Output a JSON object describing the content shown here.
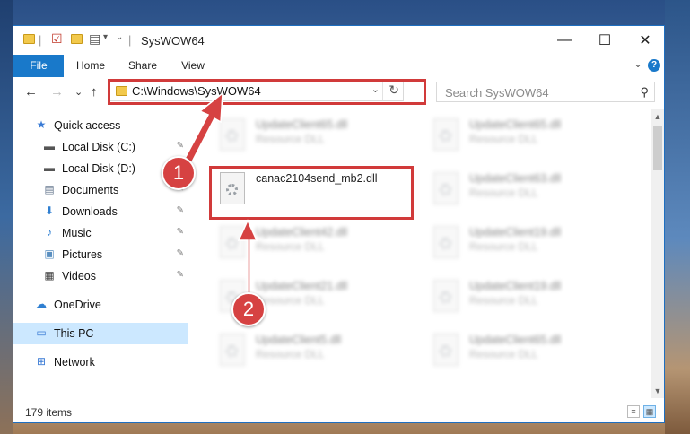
{
  "window": {
    "title": "SysWOW64",
    "controls": {
      "minimize": "—",
      "maximize": "☐",
      "close": "✕"
    }
  },
  "ribbon": {
    "tabs": [
      "File",
      "Home",
      "Share",
      "View"
    ],
    "expand_glyph": "⌄",
    "help_glyph": "?"
  },
  "nav": {
    "back": "←",
    "forward": "→",
    "recent": "⌄",
    "up": "↑",
    "address": "C:\\Windows\\SysWOW64",
    "address_dropdown": "⌄",
    "refresh": "↻",
    "search_placeholder": "Search SysWOW64"
  },
  "sidebar": {
    "items": [
      {
        "label": "Quick access",
        "icon": "star-icon",
        "glyph": "★",
        "color": "#3a7bd5",
        "pinned": false
      },
      {
        "label": "Local Disk (C:)",
        "icon": "drive-icon",
        "glyph": "▬",
        "color": "#555555",
        "pinned": true
      },
      {
        "label": "Local Disk (D:)",
        "icon": "drive-icon",
        "glyph": "▬",
        "color": "#555555",
        "pinned": true
      },
      {
        "label": "Documents",
        "icon": "documents-icon",
        "glyph": "▤",
        "color": "#6b7c93",
        "pinned": true
      },
      {
        "label": "Downloads",
        "icon": "downloads-icon",
        "glyph": "⬇",
        "color": "#2f7fd1",
        "pinned": true
      },
      {
        "label": "Music",
        "icon": "music-icon",
        "glyph": "♪",
        "color": "#2f7fd1",
        "pinned": true
      },
      {
        "label": "Pictures",
        "icon": "pictures-icon",
        "glyph": "▣",
        "color": "#5a8fc0",
        "pinned": true
      },
      {
        "label": "Videos",
        "icon": "videos-icon",
        "glyph": "▦",
        "color": "#444444",
        "pinned": true
      },
      {
        "label": "OneDrive",
        "icon": "onedrive-icon",
        "glyph": "☁",
        "color": "#2f7fd1",
        "pinned": false
      },
      {
        "label": "This PC",
        "icon": "this-pc-icon",
        "glyph": "▭",
        "color": "#3a7bd5",
        "pinned": false,
        "selected": true
      },
      {
        "label": "Network",
        "icon": "network-icon",
        "glyph": "⊞",
        "color": "#3a7bd5",
        "pinned": false
      }
    ],
    "pin_glyph": "📌"
  },
  "files": [
    {
      "name": "UpdateClient65.dll",
      "type": "Resource DLL",
      "blurred": true
    },
    {
      "name": "UpdateClient65.dll",
      "type": "Resource DLL",
      "blurred": true
    },
    {
      "name": "canac2104send_mb2.dll",
      "type": "",
      "blurred": false
    },
    {
      "name": "UpdateClient63.dll",
      "type": "Resource DLL",
      "blurred": true
    },
    {
      "name": "UpdateClient42.dll",
      "type": "Resource DLL",
      "blurred": true
    },
    {
      "name": "UpdateClient19.dll",
      "type": "Resource DLL",
      "blurred": true
    },
    {
      "name": "UpdateClient21.dll",
      "type": "Resource DLL",
      "blurred": true
    },
    {
      "name": "UpdateClient19.dll",
      "type": "Resource DLL",
      "blurred": true
    },
    {
      "name": "UpdateClient5.dll",
      "type": "Resource DLL",
      "blurred": true
    },
    {
      "name": "UpdateClient65.dll",
      "type": "Resource DLL",
      "blurred": true
    }
  ],
  "status": {
    "item_count": "179 items"
  },
  "annotations": {
    "badge1": "1",
    "badge2": "2",
    "color": "#d13a3a"
  }
}
